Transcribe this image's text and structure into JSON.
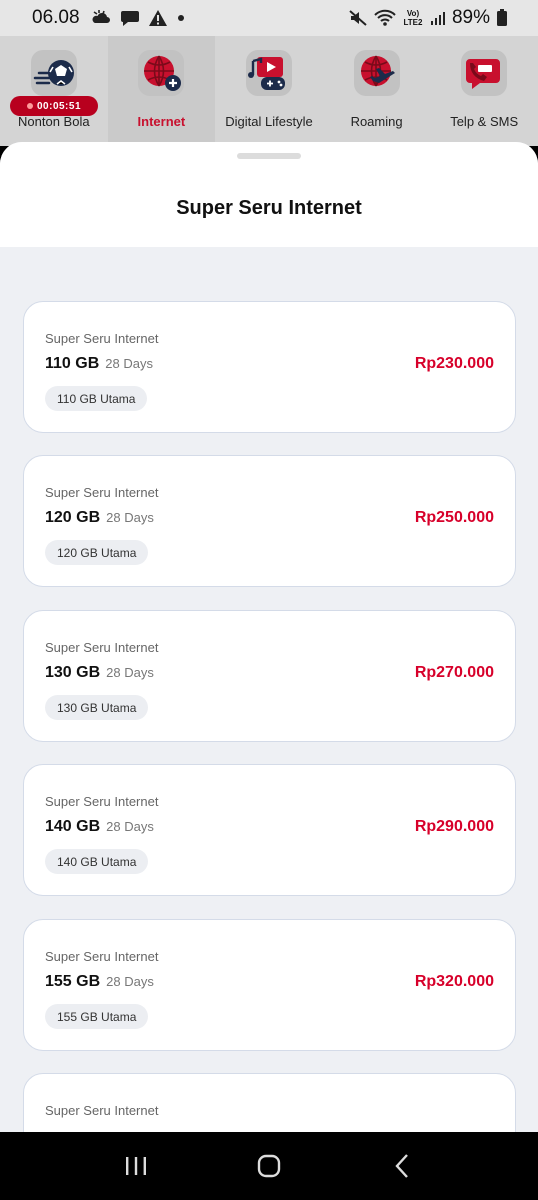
{
  "status_bar": {
    "time": "06.08",
    "network_label": "Vo) LTE2",
    "battery": "89%"
  },
  "categories": [
    {
      "label": "Nonton Bola",
      "icon": "soccer-ball-icon",
      "active": false,
      "timer": "00:05:51"
    },
    {
      "label": "Internet",
      "icon": "globe-plus-icon",
      "active": true
    },
    {
      "label": "Digital Lifestyle",
      "icon": "digital-lifestyle-icon",
      "active": false
    },
    {
      "label": "Roaming",
      "icon": "globe-airplane-icon",
      "active": false
    },
    {
      "label": "Telp & SMS",
      "icon": "phone-chat-icon",
      "active": false
    }
  ],
  "sheet": {
    "title": "Super Seru Internet"
  },
  "packages": [
    {
      "name": "Super Seru Internet",
      "quota": "110 GB",
      "days": "28 Days",
      "chip": "110 GB Utama",
      "price": "Rp230.000"
    },
    {
      "name": "Super Seru Internet",
      "quota": "120 GB",
      "days": "28 Days",
      "chip": "120 GB Utama",
      "price": "Rp250.000"
    },
    {
      "name": "Super Seru Internet",
      "quota": "130 GB",
      "days": "28 Days",
      "chip": "130 GB Utama",
      "price": "Rp270.000"
    },
    {
      "name": "Super Seru Internet",
      "quota": "140 GB",
      "days": "28 Days",
      "chip": "140 GB Utama",
      "price": "Rp290.000"
    },
    {
      "name": "Super Seru Internet",
      "quota": "155 GB",
      "days": "28 Days",
      "chip": "155 GB Utama",
      "price": "Rp320.000"
    },
    {
      "name": "Super Seru Internet"
    }
  ],
  "colors": {
    "accent_red": "#d7002a",
    "sheet_bg": "#eef0f4"
  },
  "nav": {
    "recents_icon": "recents-icon",
    "home_icon": "home-icon",
    "back_icon": "back-icon"
  }
}
